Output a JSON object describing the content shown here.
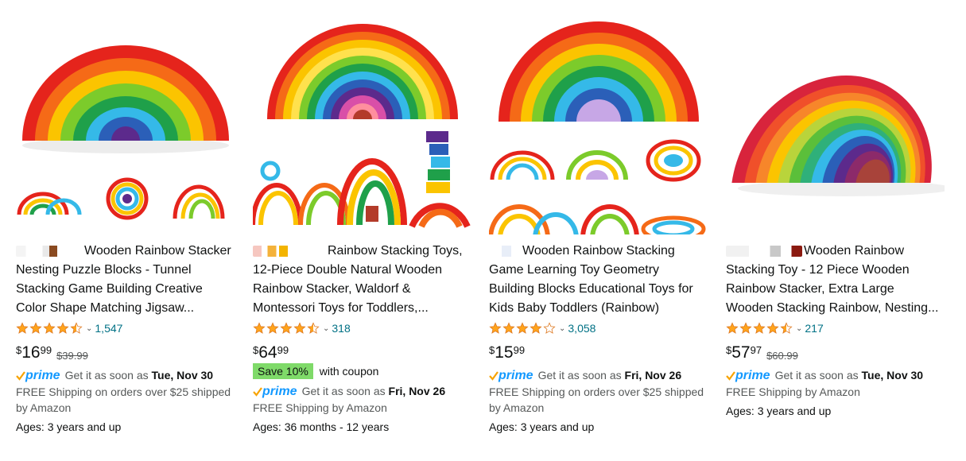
{
  "products": [
    {
      "title": "Wooden Rainbow Stacker Nesting Puzzle Blocks - Tunnel Stacking Game Building Creative Color Shape Matching Jigsaw...",
      "rating_count": "1,547",
      "stars": 4.5,
      "price_symbol": "$",
      "price_whole": "16",
      "price_fraction": "99",
      "list_price": "$39.99",
      "prime_label": "prime",
      "delivery_prefix": "Get it as soon as",
      "delivery_date": "Tue, Nov 30",
      "shipping": "FREE Shipping on orders over $25 shipped",
      "shipping_by": "by Amazon",
      "ages": "Ages: 3 years and up"
    },
    {
      "title": "Rainbow Stacking Toys, 12-Piece Double Natural Wooden Rainbow Stacker, Waldorf & Montessori Toys for Toddlers,...",
      "rating_count": "318",
      "stars": 4.5,
      "price_symbol": "$",
      "price_whole": "64",
      "price_fraction": "99",
      "coupon_badge": "Save 10%",
      "coupon_text": "with coupon",
      "prime_label": "prime",
      "delivery_prefix": "Get it as soon as",
      "delivery_date": "Fri, Nov 26",
      "shipping": "FREE Shipping by Amazon",
      "ages": "Ages: 36 months - 12 years"
    },
    {
      "title": "Wooden Rainbow Stacking Game Learning Toy Geometry Building Blocks Educational Toys for Kids Baby Toddlers (Rainbow)",
      "rating_count": "3,058",
      "stars": 4.0,
      "price_symbol": "$",
      "price_whole": "15",
      "price_fraction": "99",
      "prime_label": "prime",
      "delivery_prefix": "Get it as soon as",
      "delivery_date": "Fri, Nov 26",
      "shipping": "FREE Shipping on orders over $25 shipped",
      "shipping_by": "by Amazon",
      "ages": "Ages: 3 years and up"
    },
    {
      "title": "Wooden Rainbow Stacking Toy - 12 Piece Wooden Rainbow Stacker, Extra Large Wooden Stacking Rainbow, Nesting...",
      "rating_count": "217",
      "stars": 4.5,
      "price_symbol": "$",
      "price_whole": "57",
      "price_fraction": "97",
      "list_price": "$60.99",
      "prime_label": "prime",
      "delivery_prefix": "Get it as soon as",
      "delivery_date": "Tue, Nov 30",
      "shipping": "FREE Shipping by Amazon",
      "ages": "Ages: 3 years and up"
    }
  ],
  "colors": {
    "link": "#007185",
    "star": "#ffa41c",
    "prime_blue": "#1399ff",
    "prime_check": "#f7a300",
    "coupon_bg": "#7fda69",
    "muted": "#565959"
  },
  "icons": {
    "rating_chevron": "chevron-down-icon",
    "star": "star-icon",
    "prime_check": "check-icon"
  }
}
